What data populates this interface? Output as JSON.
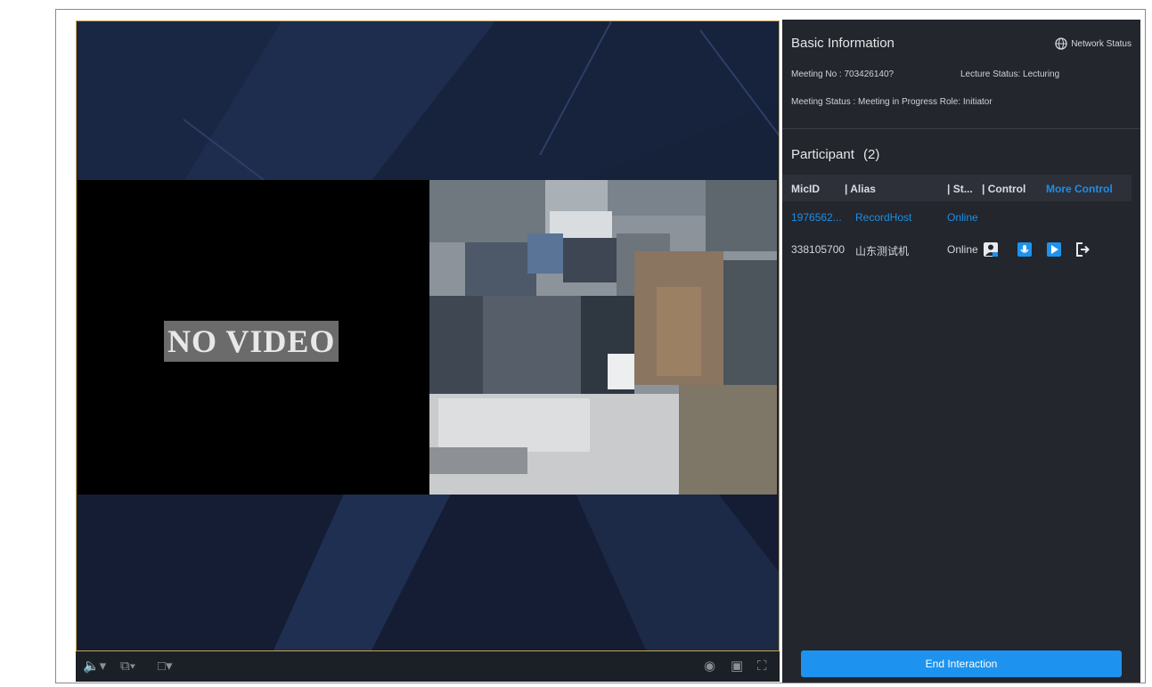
{
  "video": {
    "no_video_label": "NO VIDEO"
  },
  "toolbar": {
    "left_icons": [
      "speaker-icon",
      "layout-icon",
      "screen-mode-icon"
    ],
    "right_icons": [
      "snapshot-icon",
      "record-icon",
      "fullscreen-icon"
    ]
  },
  "basic_info": {
    "title": "Basic Information",
    "network_status": "Network Status",
    "meeting_no_label": "Meeting No :",
    "meeting_no": "703426140?",
    "lecture_status_label": "Lecture Status:",
    "lecture_status": "Lecturing",
    "meeting_status_label": "Meeting Status :",
    "meeting_status": "Meeting in Progress",
    "role_label": "Role:",
    "role": "Initiator"
  },
  "participants": {
    "title": "Participant",
    "count": "(2)",
    "columns": [
      "MicID",
      "| Alias",
      "| St...",
      "| Control"
    ],
    "more_control": "More Control",
    "rows": [
      {
        "micid": "1976562...",
        "alias": "RecordHost",
        "status": "Online"
      },
      {
        "micid": "338105700",
        "alias": "山东测试机",
        "status": "Online"
      }
    ]
  },
  "actions": {
    "end_interaction": "End Interaction"
  },
  "colors": {
    "accent": "#1d93ef",
    "panel_bg": "#23262c",
    "video_bg": "#16213a"
  }
}
